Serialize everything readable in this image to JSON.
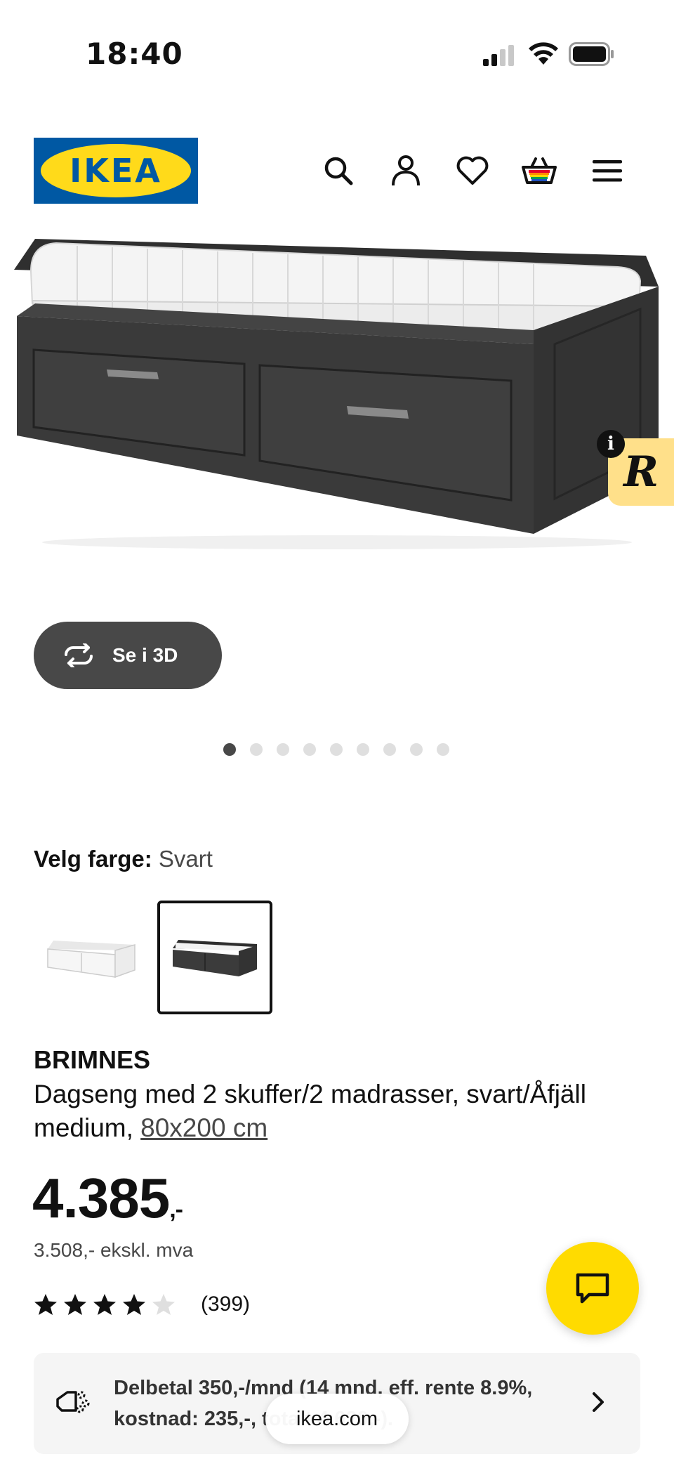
{
  "status_bar": {
    "time": "18:40"
  },
  "header": {
    "logo_text": "IKEA",
    "brand_colors": {
      "blue": "#0058a3",
      "yellow": "#ffda1a"
    },
    "icons": [
      "search-icon",
      "user-icon",
      "heart-icon",
      "cart-icon",
      "menu-icon"
    ]
  },
  "gallery": {
    "view_3d_label": "Se i 3D",
    "dots_count": 9,
    "active_dot": 0
  },
  "color_picker": {
    "label": "Velg farge:",
    "value": "Svart",
    "swatches": [
      "Hvit",
      "Svart"
    ],
    "selected_index": 1
  },
  "product": {
    "name": "BRIMNES",
    "description": "Dagseng med 2 skuffer/2 madrasser, svart/Åfjäll medium, ",
    "size_link": "80x200 cm",
    "price": "4.385",
    "price_suffix": ",-",
    "price_ex_vat": "3.508,- ekskl. mva",
    "rating": 4.0,
    "rating_max": 5,
    "rating_count": "(399)"
  },
  "installment": {
    "text": "Delbetal 350,-/mnd (14 mnd, eff. rente 8.9%, kostnad: 235,-, totalt 4.620,-)."
  },
  "browser": {
    "url": "ikea.com"
  },
  "colors": {
    "accent_yellow": "#ffdb00",
    "dark_gray": "#484848"
  }
}
